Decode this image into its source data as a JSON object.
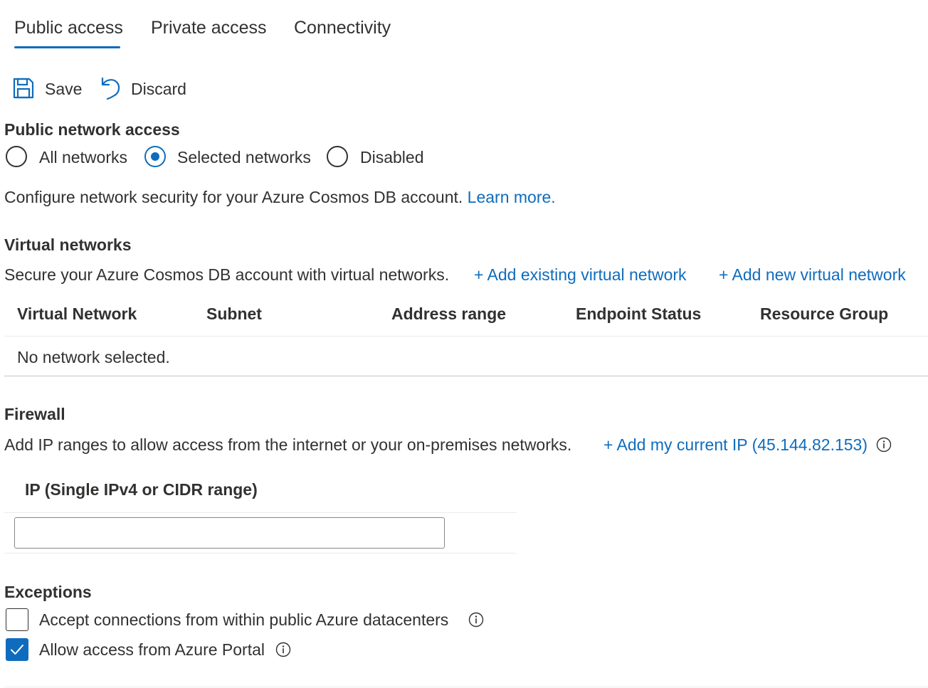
{
  "tabs": [
    {
      "label": "Public access",
      "active": true
    },
    {
      "label": "Private access",
      "active": false
    },
    {
      "label": "Connectivity",
      "active": false
    }
  ],
  "toolbar": {
    "save_label": "Save",
    "discard_label": "Discard"
  },
  "public_network_access": {
    "title": "Public network access",
    "options": [
      {
        "label": "All networks",
        "checked": false
      },
      {
        "label": "Selected networks",
        "checked": true
      },
      {
        "label": "Disabled",
        "checked": false
      }
    ]
  },
  "configure": {
    "text": "Configure network security for your Azure Cosmos DB account.",
    "learn_more": "Learn more."
  },
  "virtual_networks": {
    "title": "Virtual networks",
    "description": "Secure your Azure Cosmos DB account with virtual networks.",
    "add_existing": "+ Add existing virtual network",
    "add_new": "+ Add new virtual network",
    "columns": [
      "Virtual Network",
      "Subnet",
      "Address range",
      "Endpoint Status",
      "Resource Group"
    ],
    "empty_text": "No network selected."
  },
  "firewall": {
    "title": "Firewall",
    "description": "Add IP ranges to allow access from the internet or your on-premises networks.",
    "add_ip": "+ Add my current IP (45.144.82.153)",
    "ip_column": "IP (Single IPv4 or CIDR range)",
    "ip_value": ""
  },
  "exceptions": {
    "title": "Exceptions",
    "items": [
      {
        "label": "Accept connections from within public Azure datacenters",
        "checked": false
      },
      {
        "label": "Allow access from Azure Portal",
        "checked": true
      }
    ]
  },
  "colors": {
    "accent": "#0f6cbd",
    "text": "#323130",
    "border": "#edebe9"
  }
}
